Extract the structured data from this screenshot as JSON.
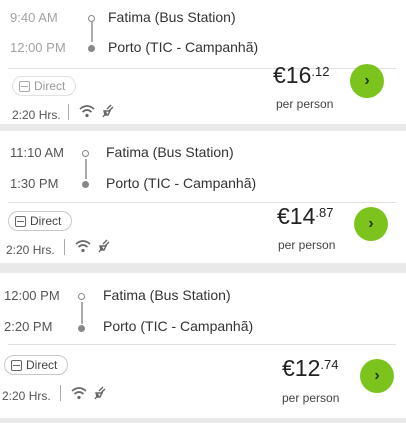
{
  "trips": [
    {
      "departure_time": "9:40 AM",
      "arrival_time": "12:00 PM",
      "origin": "Fatima (Bus Station)",
      "destination": "Porto (TIC - Campanhã)",
      "badge_label": "Direct",
      "duration": "2:20 Hrs.",
      "price_main": "€16",
      "price_cents": ".12",
      "price_note": "per person",
      "amenities": [
        "wifi-icon",
        "plug-icon"
      ]
    },
    {
      "departure_time": "11:10 AM",
      "arrival_time": "1:30 PM",
      "origin": "Fatima (Bus Station)",
      "destination": "Porto (TIC - Campanhã)",
      "badge_label": "Direct",
      "duration": "2:20 Hrs.",
      "price_main": "€14",
      "price_cents": ".87",
      "price_note": "per person",
      "amenities": [
        "wifi-icon",
        "plug-icon"
      ]
    },
    {
      "departure_time": "12:00 PM",
      "arrival_time": "2:20 PM",
      "origin": "Fatima (Bus Station)",
      "destination": "Porto (TIC - Campanhã)",
      "badge_label": "Direct",
      "duration": "2:20 Hrs.",
      "price_main": "€12",
      "price_cents": ".74",
      "price_note": "per person",
      "amenities": [
        "wifi-icon",
        "plug-icon"
      ]
    }
  ],
  "go_button_glyph": "›",
  "colors": {
    "accent": "#7cc41d",
    "background": "#e9e9e9",
    "card": "#ffffff"
  }
}
